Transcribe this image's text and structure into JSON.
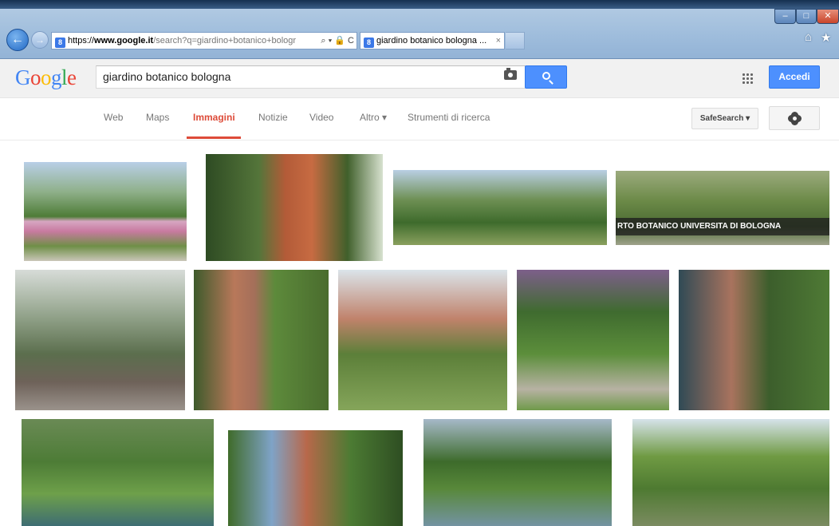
{
  "browser": {
    "url_prefix": "https://",
    "url_host": "www.google.it",
    "url_rest": "/search?q=giardino+botanico+bologr",
    "address_controls": "⌕ ▾ 🔒 C",
    "tab_title": "giardino botanico bologna ...",
    "tab_close": "×",
    "back_glyph": "←",
    "forward_glyph": "→",
    "home_glyph": "⌂",
    "favorites_glyph": "★",
    "minimize_glyph": "–",
    "maximize_glyph": "□",
    "close_glyph": "✕"
  },
  "google": {
    "logo_letters": [
      "G",
      "o",
      "o",
      "g",
      "l",
      "e"
    ],
    "logo_colors": [
      "#4285f4",
      "#ea4335",
      "#fbbc05",
      "#4285f4",
      "#34a853",
      "#ea4335"
    ],
    "search_query": "giardino botanico bologna",
    "signin_label": "Accedi"
  },
  "nav": {
    "tabs": [
      "Web",
      "Maps",
      "Immagini",
      "Notizie",
      "Video",
      "Altro ▾",
      "Strumenti di ricerca"
    ],
    "active_tab": "Immagini",
    "safesearch_label": "SafeSearch ▾"
  },
  "results": {
    "caption_4": "RTO BOTANICO UNIVERSITA DI BOLOGNA"
  },
  "colors": {
    "accent_blue": "#4d90fe",
    "active_red": "#dd4b39"
  }
}
